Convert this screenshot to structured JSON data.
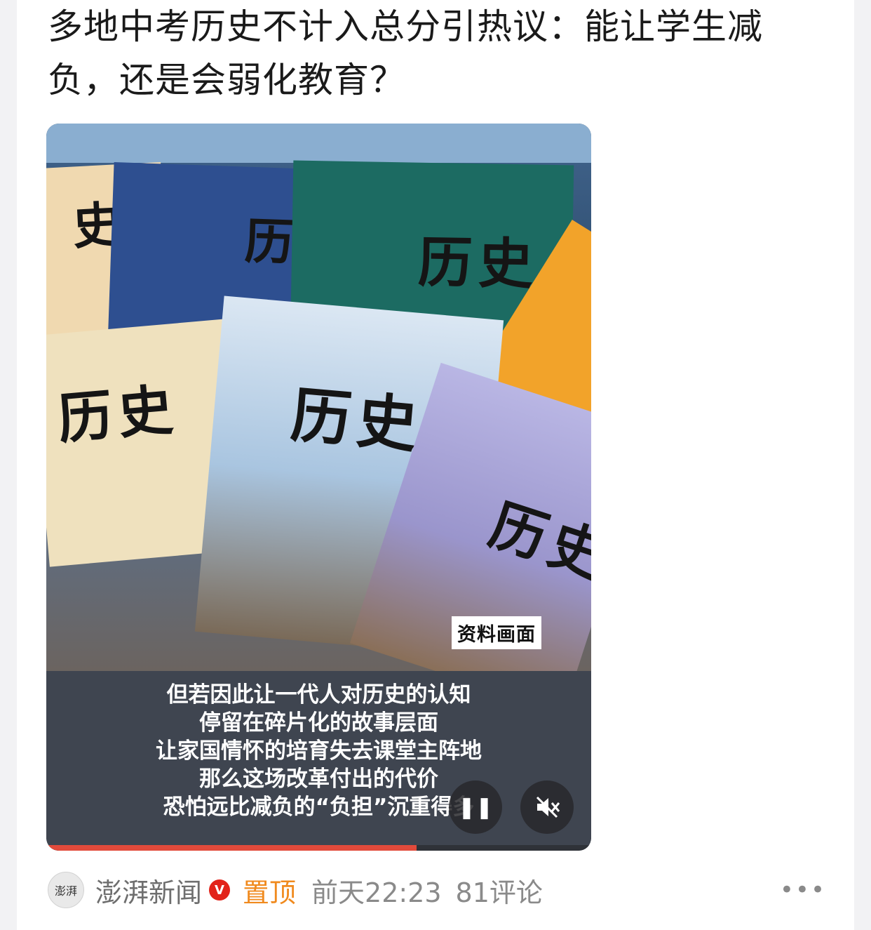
{
  "headline": {
    "line1": "多地中考历史不计入总分引热议：能让学生减",
    "line2": "负，还是会弱化教育？"
  },
  "video": {
    "book_titles": {
      "top_left": "史",
      "blue": "历",
      "green": "历史",
      "beige": "历史",
      "light": "历史",
      "purple": "历史"
    },
    "tag": "资料画面",
    "captions": [
      "但若因此让一代人对历史的认知",
      "停留在碎片化的故事层面",
      "让家国情怀的培育失去课堂主阵地",
      "那么这场改革付出的代价",
      "恐怕远比减负的“负担”沉重得多"
    ],
    "pause_icon": "pause-icon",
    "mute_icon": "mute-icon",
    "progress": 0.68,
    "progress_color": "#e24a3b"
  },
  "meta": {
    "avatar_text": "澎湃",
    "source": "澎湃新闻",
    "verified_badge": "V",
    "pinned": "置顶",
    "time": "前天22:23",
    "comments": "81评论",
    "more_icon": "more-icon"
  },
  "colors": {
    "pinned": "#f08a1e",
    "verified": "#e2231a"
  }
}
